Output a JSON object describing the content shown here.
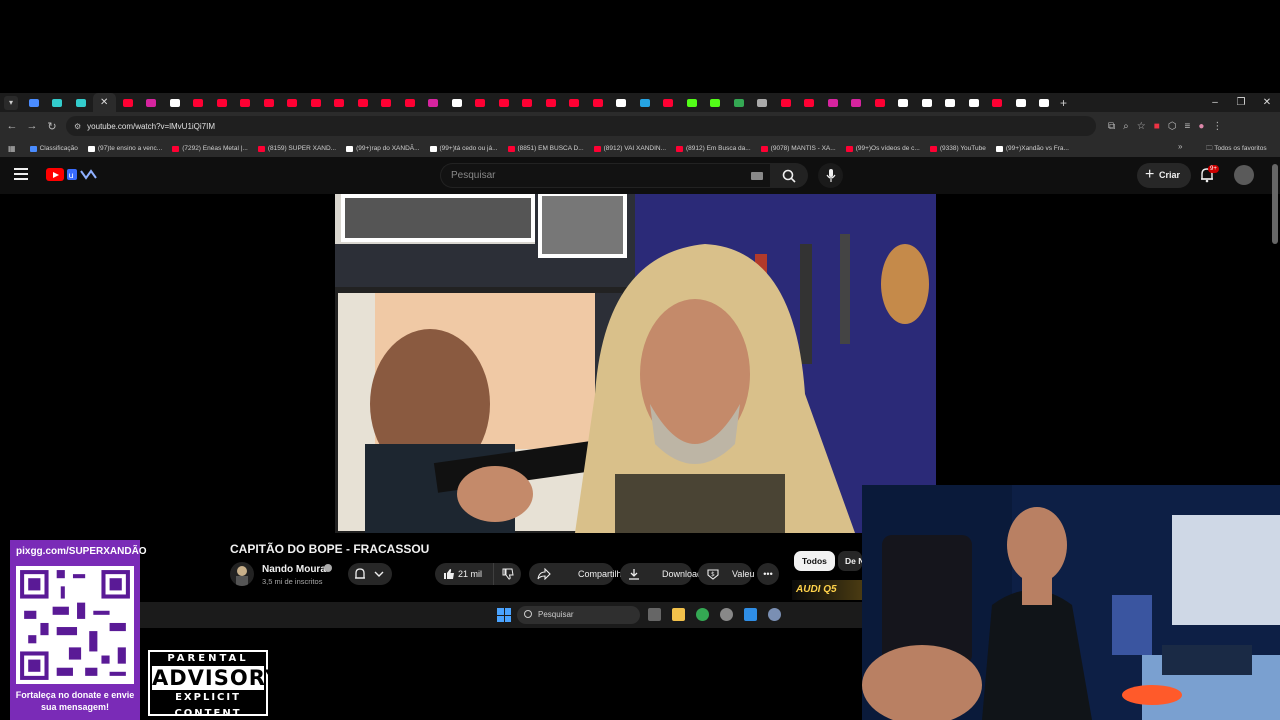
{
  "browser": {
    "tab_favicon_colors": [
      "#4a8cff",
      "#3cc",
      "#3cc",
      "#ff0033",
      "#ff0033",
      "#d6249f",
      "#ffffff",
      "#ff0033",
      "#ff0033",
      "#ff0033",
      "#ff0033",
      "#ff0033",
      "#ff0033",
      "#ff0033",
      "#ff0033",
      "#ff0033",
      "#ff0033",
      "#d6249f",
      "#ffffff",
      "#ff0033",
      "#ff0033",
      "#ff0033",
      "#ff0033",
      "#ff0033",
      "#ff0033",
      "#ffffff",
      "#26a5e4",
      "#ff0033",
      "#53fc18",
      "#53fc18",
      "#34a853",
      "#aaaaaa",
      "#ff0033",
      "#ff0033",
      "#d6249f",
      "#d6249f",
      "#ff0033",
      "#ffffff",
      "#ffffff",
      "#ffffff",
      "#ffffff",
      "#ff0033",
      "#ffffff",
      "#ffffff"
    ],
    "address": {
      "url": "youtube.com/watch?v=lMvU1iQi7IM"
    },
    "bookmarks": [
      {
        "label": "Classificação",
        "color": "#4a8cff"
      },
      {
        "label": "(97)te ensino a venc...",
        "color": "#ffffff"
      },
      {
        "label": "(7292) Enéas Metal |...",
        "color": "#ff0033"
      },
      {
        "label": "(8159) SUPER XAND...",
        "color": "#ff0033"
      },
      {
        "label": "(99+)rap do XANDÃ...",
        "color": "#ffffff"
      },
      {
        "label": "(99+)tá cedo ou já...",
        "color": "#ffffff"
      },
      {
        "label": "(8851) EM BUSCA D...",
        "color": "#ff0033"
      },
      {
        "label": "(8912) VAI XANDIN...",
        "color": "#ff0033"
      },
      {
        "label": "(8912) Em Busca da...",
        "color": "#ff0033"
      },
      {
        "label": "(9078) MANTIS - XA...",
        "color": "#ff0033"
      },
      {
        "label": "(99+)Os vídeos de c...",
        "color": "#ff0033"
      },
      {
        "label": "(9338) YouTube",
        "color": "#ff0033"
      },
      {
        "label": "(99+)Xandão vs Fra...",
        "color": "#ffffff"
      }
    ],
    "all_bookmarks": "Todos os favoritos"
  },
  "youtube": {
    "search_placeholder": "Pesquisar",
    "create_label": "Criar",
    "notif_count": "9+",
    "video_title": "CAPITÃO DO BOPE - FRACASSOU",
    "channel_name": "Nando Moura",
    "subscribers": "3,5 mi de inscritos",
    "like_count": "21 mil",
    "share_label": "Compartilhar",
    "download_label": "Download",
    "thanks_label": "Valeu",
    "chips": [
      "Todos",
      "De Nando Moura"
    ],
    "thumb_ad_text": "AUDI Q5"
  },
  "taskbar": {
    "search_placeholder": "Pesquisar"
  },
  "overlay": {
    "qr_url": "pixgg.com/SUPERXANDÃO",
    "qr_caption": "Fortaleça no donate e envie sua mensagem!",
    "advisory_top": "PARENTAL",
    "advisory_main": "ADVISORY",
    "advisory_bottom": "EXPLICIT CONTENT"
  }
}
